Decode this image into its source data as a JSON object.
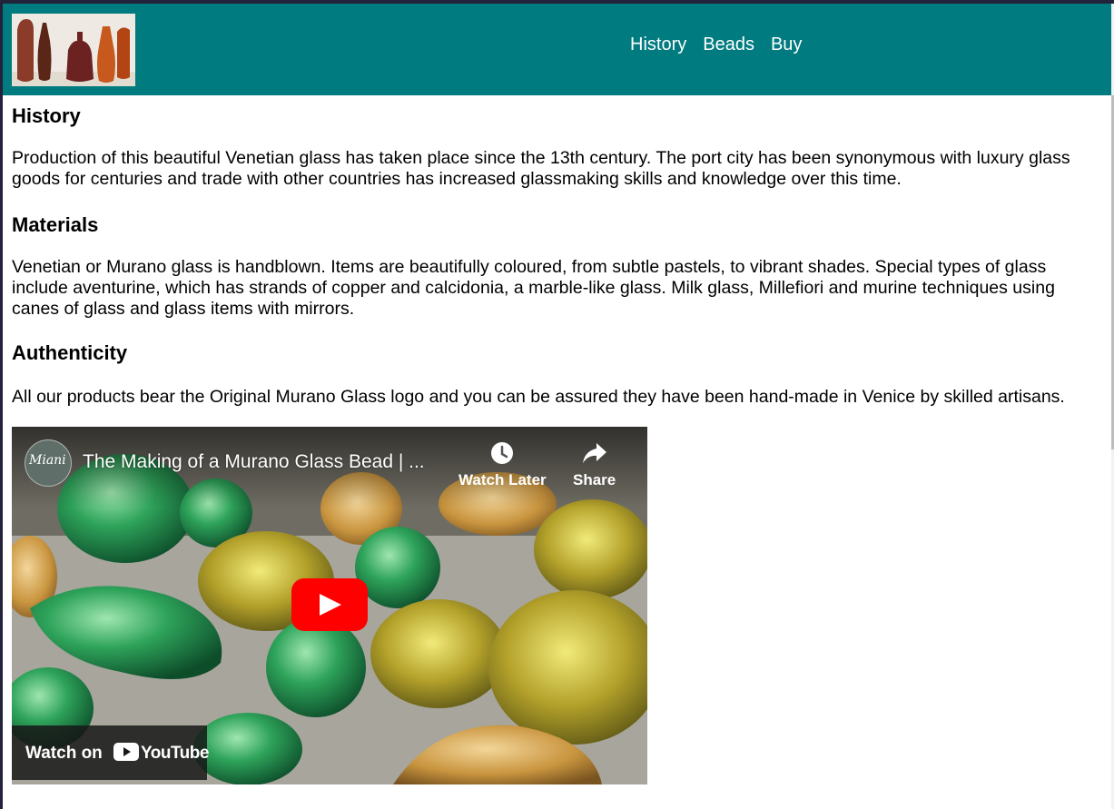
{
  "nav": {
    "links": [
      "History",
      "Beads",
      "Buy"
    ]
  },
  "sections": {
    "history": {
      "heading": "History",
      "text": "Production of this beautiful Venetian glass has taken place since the 13th century. The port city has been synonymous with luxury glass goods for centuries and trade with other countries has increased glassmaking skills and knowledge over this time."
    },
    "materials": {
      "heading": "Materials",
      "text": "Venetian or Murano glass is handblown. Items are beautifully coloured, from subtle pastels, to vibrant shades. Special types of glass include aventurine, which has strands of copper and calcidonia, a marble-like glass. Milk glass, Millefiori and murine techniques using canes of glass and glass items with mirrors."
    },
    "authenticity": {
      "heading": "Authenticity",
      "text": "All our products bear the Original Murano Glass logo and you can be assured they have been hand-made in Venice by skilled artisans."
    }
  },
  "video": {
    "title": "The Making of a Murano Glass Bead | ...",
    "channel_logo_text": "Miani",
    "watch_later": "Watch Later",
    "share": "Share",
    "watch_on": "Watch on",
    "youtube": "YouTube"
  },
  "colors": {
    "header_bg": "#007b7f",
    "play_button": "#ff0000"
  }
}
